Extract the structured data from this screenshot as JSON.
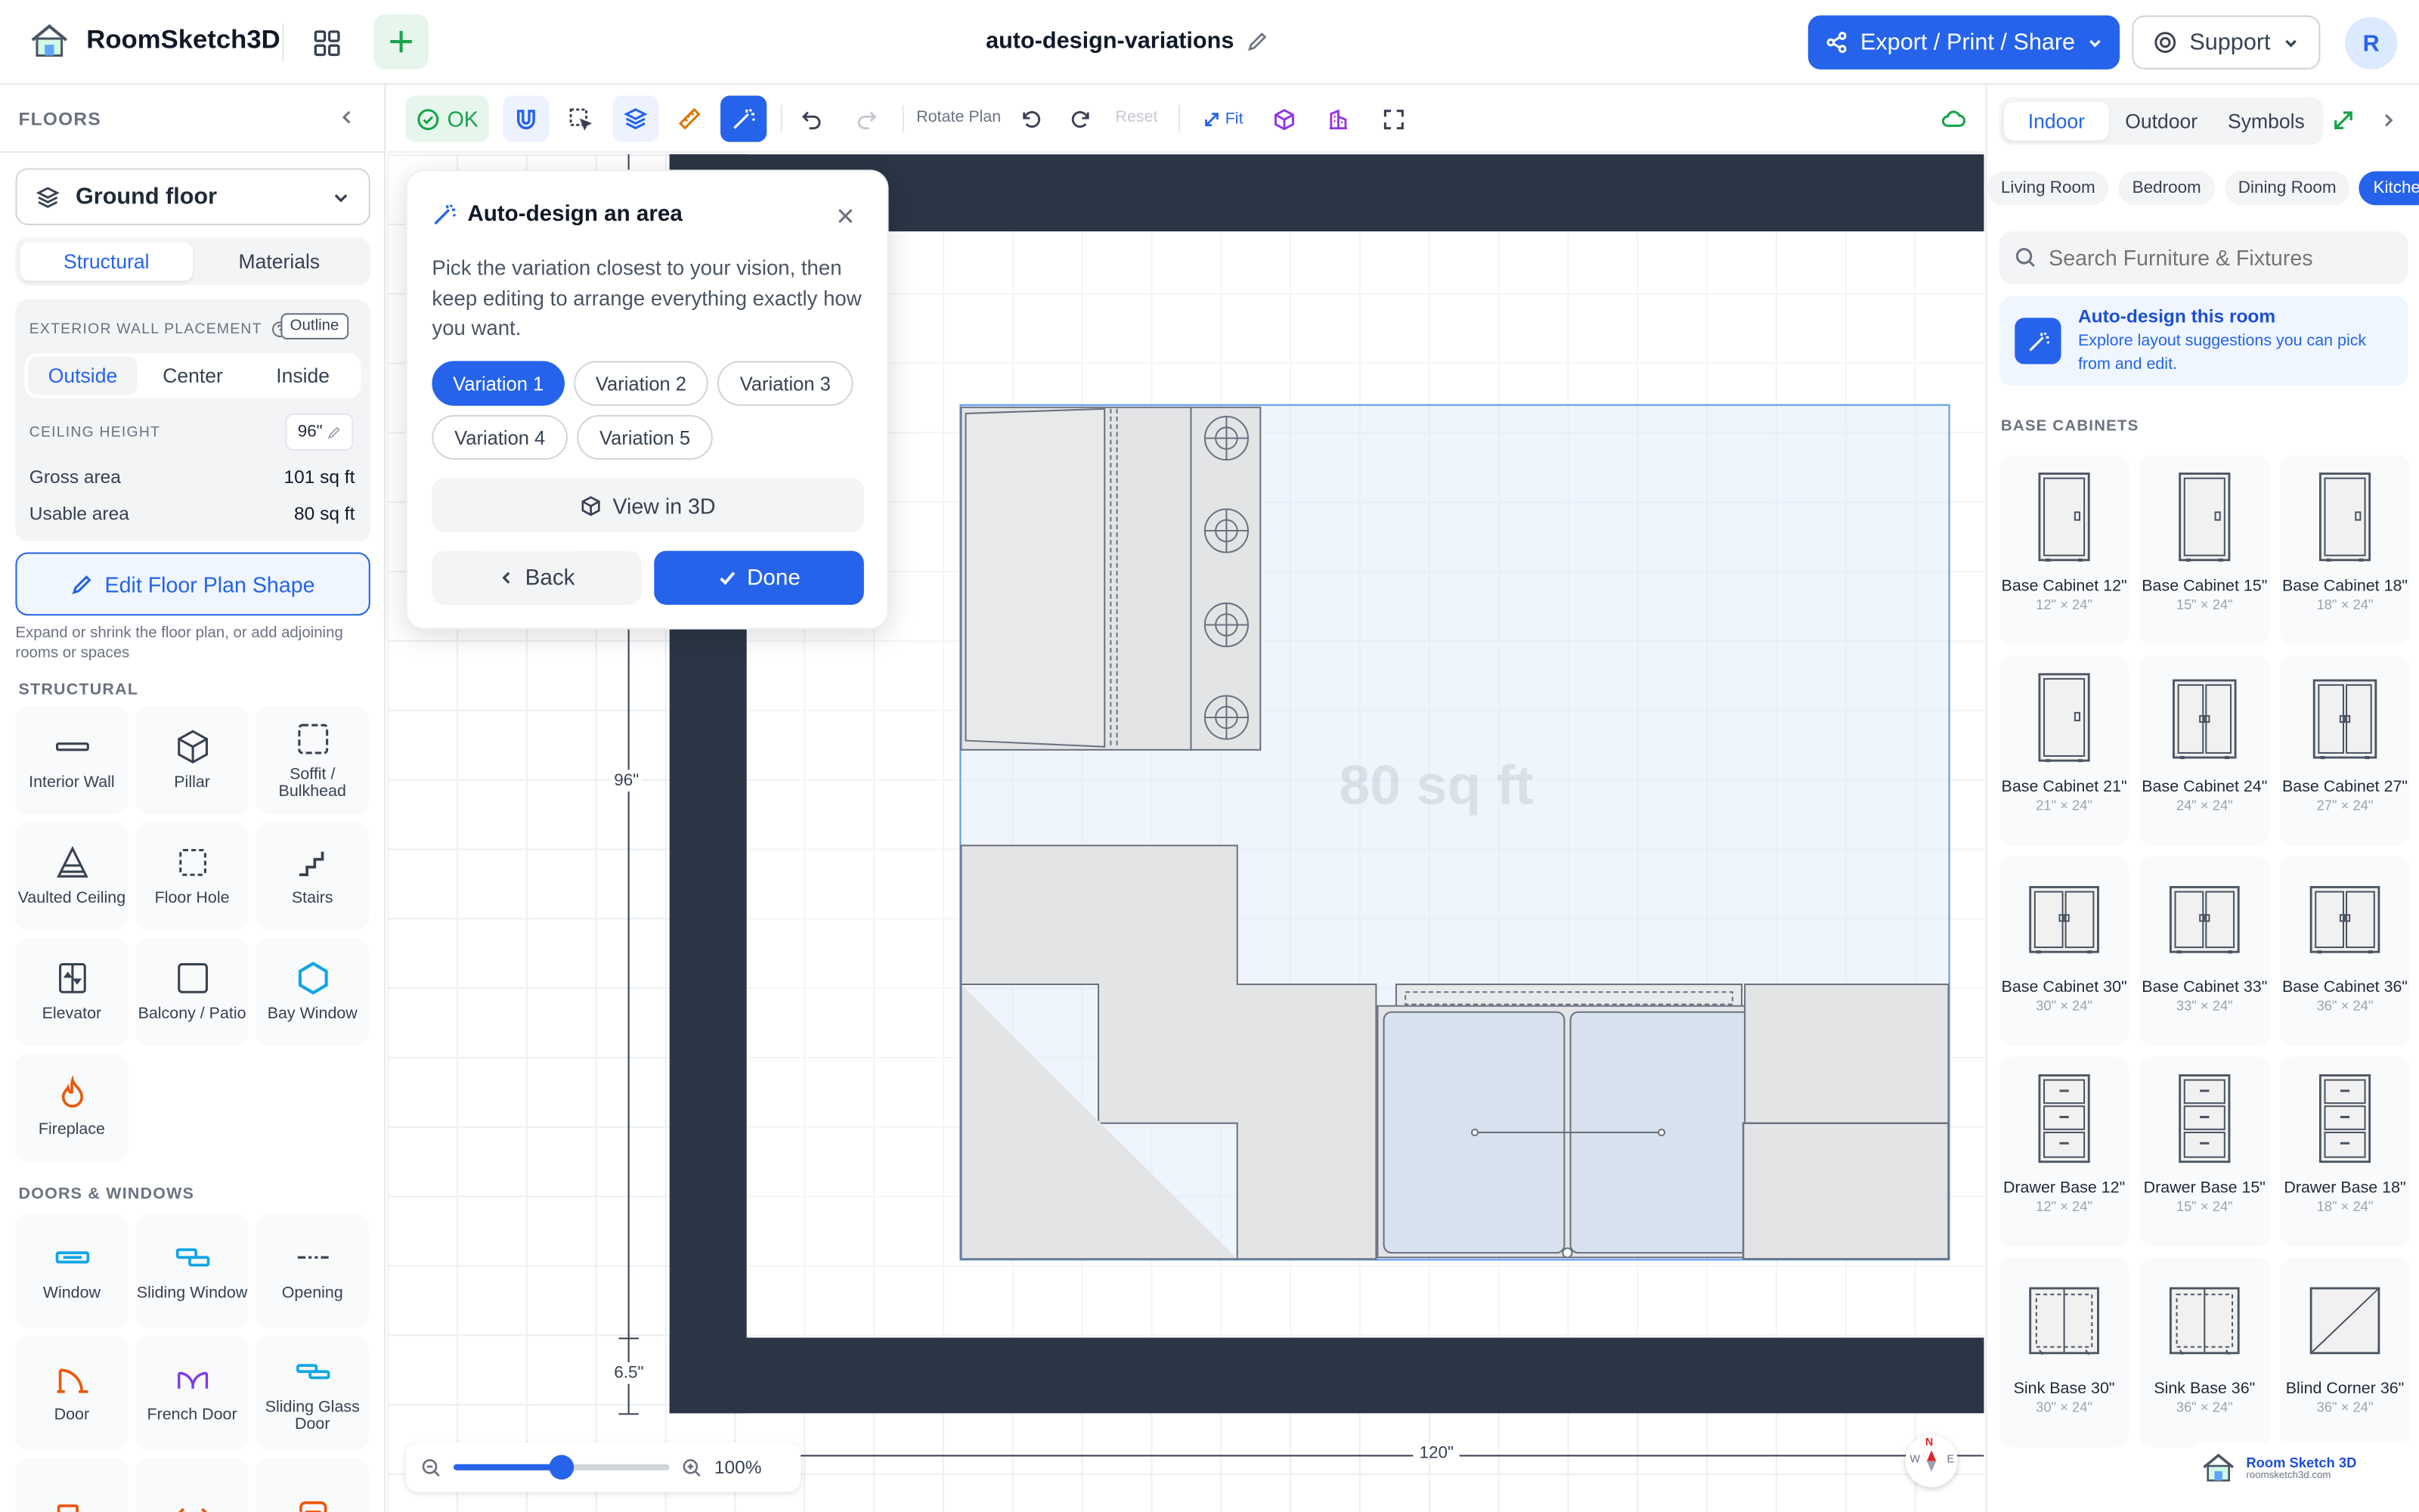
{
  "app": {
    "name": "RoomSketch3D"
  },
  "header": {
    "document_title": "auto-design-variations",
    "export_label": "Export / Print / Share",
    "support_label": "Support",
    "avatar_initial": "R"
  },
  "left_panel": {
    "title": "FLOORS",
    "floor_select": "Ground floor",
    "tabs": [
      "Structural",
      "Materials"
    ],
    "active_tab": "Structural",
    "wall_placement": {
      "label": "EXTERIOR WALL PLACEMENT",
      "badge": "Outline",
      "options": [
        "Outside",
        "Center",
        "Inside"
      ],
      "selected": "Outside"
    },
    "ceiling": {
      "label": "CEILING HEIGHT",
      "value": "96\""
    },
    "gross_area": {
      "label": "Gross area",
      "value": "101 sq ft"
    },
    "usable_area": {
      "label": "Usable area",
      "value": "80 sq ft"
    },
    "edit_shape_label": "Edit Floor Plan Shape",
    "edit_shape_help": "Expand or shrink the floor plan, or add adjoining rooms or spaces",
    "structural_title": "STRUCTURAL",
    "structural_tools": [
      {
        "label": "Interior Wall",
        "icon": "interior-wall-icon"
      },
      {
        "label": "Pillar",
        "icon": "pillar-icon"
      },
      {
        "label": "Soffit / Bulkhead",
        "icon": "soffit-icon"
      },
      {
        "label": "Vaulted Ceiling",
        "icon": "vaulted-ceiling-icon"
      },
      {
        "label": "Floor Hole",
        "icon": "floor-hole-icon"
      },
      {
        "label": "Stairs",
        "icon": "stairs-icon"
      },
      {
        "label": "Elevator",
        "icon": "elevator-icon"
      },
      {
        "label": "Balcony / Patio",
        "icon": "balcony-icon"
      },
      {
        "label": "Bay Window",
        "icon": "bay-window-icon"
      },
      {
        "label": "Fireplace",
        "icon": "fireplace-icon"
      }
    ],
    "doors_title": "DOORS & WINDOWS",
    "door_tools": [
      {
        "label": "Window",
        "icon": "window-icon"
      },
      {
        "label": "Sliding Window",
        "icon": "sliding-window-icon"
      },
      {
        "label": "Opening",
        "icon": "opening-icon"
      },
      {
        "label": "Door",
        "icon": "door-icon"
      },
      {
        "label": "French Door",
        "icon": "french-door-icon"
      },
      {
        "label": "Sliding Glass Door",
        "icon": "sliding-glass-door-icon"
      }
    ]
  },
  "toolbar": {
    "ok_label": "OK",
    "rotate_label": "Rotate Plan",
    "reset_label": "Reset",
    "fit_label": "Fit"
  },
  "canvas": {
    "area_label": "80 sq ft",
    "dim_height": "96\"",
    "dim_wall": "6.5\"",
    "dim_width": "120\"",
    "zoom_value": "100%",
    "zoom_level": 0.5,
    "compass": {
      "n": "N",
      "w": "W",
      "e": "E"
    },
    "watermark": {
      "title": "Room Sketch 3D",
      "url": "roomsketch3d.com"
    }
  },
  "popup": {
    "title": "Auto-design an area",
    "description": "Pick the variation closest to your vision, then keep editing to arrange everything exactly how you want.",
    "variations": [
      "Variation 1",
      "Variation 2",
      "Variation 3",
      "Variation 4",
      "Variation 5"
    ],
    "selected": "Variation 1",
    "view3d_label": "View in 3D",
    "back_label": "Back",
    "done_label": "Done"
  },
  "right_panel": {
    "tabs": [
      "Indoor",
      "Outdoor",
      "Symbols"
    ],
    "active_tab": "Indoor",
    "room_chips": [
      "Living Room",
      "Bedroom",
      "Dining Room",
      "Kitchen"
    ],
    "active_chip": "Kitchen",
    "search_placeholder": "Search Furniture & Fixtures",
    "autodesign": {
      "title": "Auto-design this room",
      "desc": "Explore layout suggestions you can pick from and edit."
    },
    "section_title": "BASE CABINETS",
    "cabinets": [
      {
        "name": "Base Cabinet 12\"",
        "dims": "12\" × 24\"",
        "kind": "single"
      },
      {
        "name": "Base Cabinet 15\"",
        "dims": "15\" × 24\"",
        "kind": "single"
      },
      {
        "name": "Base Cabinet 18\"",
        "dims": "18\" × 24\"",
        "kind": "single"
      },
      {
        "name": "Base Cabinet 21\"",
        "dims": "21\" × 24\"",
        "kind": "single"
      },
      {
        "name": "Base Cabinet 24\"",
        "dims": "24\" × 24\"",
        "kind": "double"
      },
      {
        "name": "Base Cabinet 27\"",
        "dims": "27\" × 24\"",
        "kind": "double"
      },
      {
        "name": "Base Cabinet 30\"",
        "dims": "30\" × 24\"",
        "kind": "wide"
      },
      {
        "name": "Base Cabinet 33\"",
        "dims": "33\" × 24\"",
        "kind": "wide"
      },
      {
        "name": "Base Cabinet 36\"",
        "dims": "36\" × 24\"",
        "kind": "wide"
      },
      {
        "name": "Drawer Base 12\"",
        "dims": "12\" × 24\"",
        "kind": "drawer"
      },
      {
        "name": "Drawer Base 15\"",
        "dims": "15\" × 24\"",
        "kind": "drawer"
      },
      {
        "name": "Drawer Base 18\"",
        "dims": "18\" × 24\"",
        "kind": "drawer"
      },
      {
        "name": "Sink Base 30\"",
        "dims": "30\" × 24\"",
        "kind": "sink"
      },
      {
        "name": "Sink Base 36\"",
        "dims": "36\" × 24\"",
        "kind": "sink"
      },
      {
        "name": "Blind Corner 36\"",
        "dims": "36\" × 24\"",
        "kind": "corner"
      }
    ]
  },
  "colors": {
    "accent": "#2563eb",
    "wall": "#2b3545",
    "ok_green": "#16a34a",
    "room_fill": "#eaf0f8"
  }
}
